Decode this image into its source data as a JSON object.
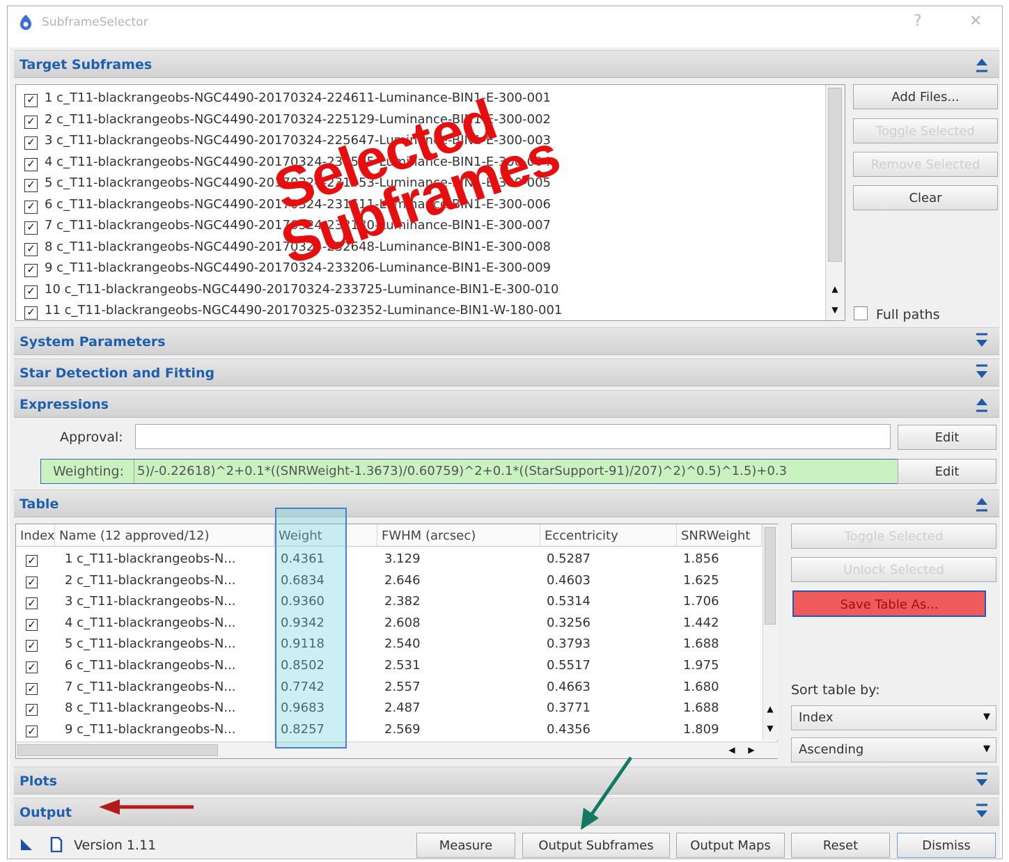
{
  "window": {
    "title": "SubframeSelector",
    "help_label": "?",
    "close_label": "✕"
  },
  "sections": {
    "target": "Target Subframes",
    "system": "System Parameters",
    "star": "Star Detection and Fitting",
    "expressions": "Expressions",
    "table": "Table",
    "plots": "Plots",
    "output": "Output"
  },
  "files": [
    "1 c_T11-blackrangeobs-NGC4490-20170324-224611-Luminance-BIN1-E-300-001",
    "2 c_T11-blackrangeobs-NGC4490-20170324-225129-Luminance-BIN1-E-300-002",
    "3 c_T11-blackrangeobs-NGC4490-20170324-225647-Luminance-BIN1-E-300-003",
    "4 c_T11-blackrangeobs-NGC4490-20170324-230535-Luminance-BIN1-E-300-004",
    "5 c_T11-blackrangeobs-NGC4490-20170324-231053-Luminance-BIN1-E-300-005",
    "6 c_T11-blackrangeobs-NGC4490-20170324-231611-Luminance-BIN1-E-300-006",
    "7 c_T11-blackrangeobs-NGC4490-20170324-232130-Luminance-BIN1-E-300-007",
    "8 c_T11-blackrangeobs-NGC4490-20170324-232648-Luminance-BIN1-E-300-008",
    "9 c_T11-blackrangeobs-NGC4490-20170324-233206-Luminance-BIN1-E-300-009",
    "10 c_T11-blackrangeobs-NGC4490-20170324-233725-Luminance-BIN1-E-300-010",
    "11 c_T11-blackrangeobs-NGC4490-20170325-032352-Luminance-BIN1-W-180-001"
  ],
  "target_buttons": {
    "add_files": "Add Files...",
    "toggle_selected": "Toggle Selected",
    "remove_selected": "Remove Selected",
    "clear": "Clear",
    "full_paths": "Full paths"
  },
  "overlay": {
    "line1": "Selected",
    "line2": "Subframes"
  },
  "expressions": {
    "approval_label": "Approval:",
    "approval_value": "",
    "weighting_label": "Weighting:",
    "weighting_value": "5)/-0.22618)^2+0.1*((SNRWeight-1.3673)/0.60759)^2+0.1*((StarSupport-91)/207)^2)^0.5)^1.5)+0.3",
    "edit_label": "Edit"
  },
  "table": {
    "headers": [
      "Index",
      "Name (12 approved/12)",
      "Weight",
      "FWHM (arcsec)",
      "Eccentricity",
      "SNRWeight"
    ],
    "rows": [
      {
        "name": "1 c_T11-blackrangeobs-N...",
        "weight": "0.4361",
        "fwhm": "3.129",
        "ecc": "0.5287",
        "snr": "1.856"
      },
      {
        "name": "2 c_T11-blackrangeobs-N...",
        "weight": "0.6834",
        "fwhm": "2.646",
        "ecc": "0.4603",
        "snr": "1.625"
      },
      {
        "name": "3 c_T11-blackrangeobs-N...",
        "weight": "0.9360",
        "fwhm": "2.382",
        "ecc": "0.5314",
        "snr": "1.706"
      },
      {
        "name": "4 c_T11-blackrangeobs-N...",
        "weight": "0.9342",
        "fwhm": "2.608",
        "ecc": "0.3256",
        "snr": "1.442"
      },
      {
        "name": "5 c_T11-blackrangeobs-N...",
        "weight": "0.9118",
        "fwhm": "2.540",
        "ecc": "0.3793",
        "snr": "1.688"
      },
      {
        "name": "6 c_T11-blackrangeobs-N...",
        "weight": "0.8502",
        "fwhm": "2.531",
        "ecc": "0.5517",
        "snr": "1.975"
      },
      {
        "name": "7 c_T11-blackrangeobs-N...",
        "weight": "0.7742",
        "fwhm": "2.557",
        "ecc": "0.4663",
        "snr": "1.680"
      },
      {
        "name": "8 c_T11-blackrangeobs-N...",
        "weight": "0.9683",
        "fwhm": "2.487",
        "ecc": "0.3771",
        "snr": "1.688"
      },
      {
        "name": "9 c_T11-blackrangeobs-N...",
        "weight": "0.8257",
        "fwhm": "2.569",
        "ecc": "0.4356",
        "snr": "1.809"
      }
    ]
  },
  "table_buttons": {
    "toggle_selected": "Toggle Selected",
    "unlock_selected": "Unlock Selected",
    "save_table_as": "Save Table As...",
    "sort_label": "Sort table by:",
    "sort_field": "Index",
    "sort_order": "Ascending"
  },
  "footer": {
    "version": "Version 1.11",
    "measure": "Measure",
    "output_subframes": "Output Subframes",
    "output_maps": "Output Maps",
    "reset": "Reset",
    "dismiss": "Dismiss"
  },
  "colors": {
    "section_title": "#1f5fb0",
    "overlay_red": "#e60e0e",
    "weight_highlight": "#c8eef0",
    "weighting_highlight": "#c9f2c0",
    "save_button": "#ef5a5a",
    "annotation_arrow_red": "#b31b1b",
    "annotation_arrow_green": "#117a60"
  }
}
